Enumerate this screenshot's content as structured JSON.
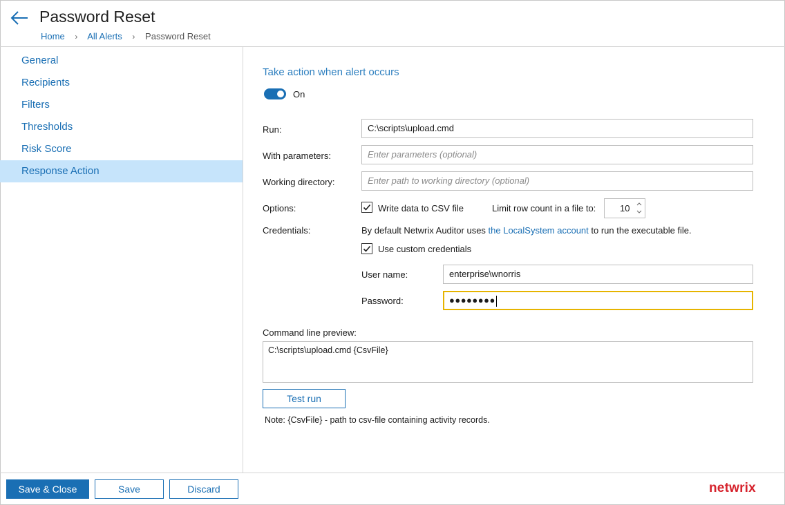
{
  "header": {
    "title": "Password Reset",
    "breadcrumbs": [
      "Home",
      "All Alerts",
      "Password Reset"
    ]
  },
  "sidebar": {
    "items": [
      {
        "label": "General",
        "active": false
      },
      {
        "label": "Recipients",
        "active": false
      },
      {
        "label": "Filters",
        "active": false
      },
      {
        "label": "Thresholds",
        "active": false
      },
      {
        "label": "Risk Score",
        "active": false
      },
      {
        "label": "Response Action",
        "active": true
      }
    ]
  },
  "main": {
    "section_title": "Take action when alert occurs",
    "toggle": {
      "state": true,
      "label": "On"
    },
    "run": {
      "label": "Run:",
      "value": "C:\\scripts\\upload.cmd"
    },
    "parameters": {
      "label": "With parameters:",
      "placeholder": "Enter parameters (optional)"
    },
    "working_dir": {
      "label": "Working directory:",
      "placeholder": "Enter path to working directory (optional)"
    },
    "options": {
      "label": "Options:",
      "write_csv": {
        "label": "Write data to CSV file",
        "checked": true
      },
      "limit_label": "Limit row count in a file to:",
      "limit_value": "10"
    },
    "credentials": {
      "label": "Credentials:",
      "text_before": "By default Netwrix Auditor uses ",
      "link": "the LocalSystem account",
      "text_after": " to run the executable file.",
      "custom": {
        "label": "Use custom credentials",
        "checked": true
      },
      "username_label": "User name:",
      "username_value": "enterprise\\wnorris",
      "password_label": "Password:",
      "password_value": "●●●●●●●●"
    },
    "preview": {
      "label": "Command line preview:",
      "value": "C:\\scripts\\upload.cmd {CsvFile}"
    },
    "test_run_label": "Test run",
    "note": "Note: {CsvFile} - path to csv-file containing activity records."
  },
  "footer": {
    "save_close_label": "Save & Close",
    "save_label": "Save",
    "discard_label": "Discard",
    "brand": "netwrix"
  },
  "colors": {
    "accent": "#1a6fb4",
    "active_nav_bg": "#c6e4fb",
    "focus_border": "#e6b400",
    "brand": "#d6232d"
  }
}
